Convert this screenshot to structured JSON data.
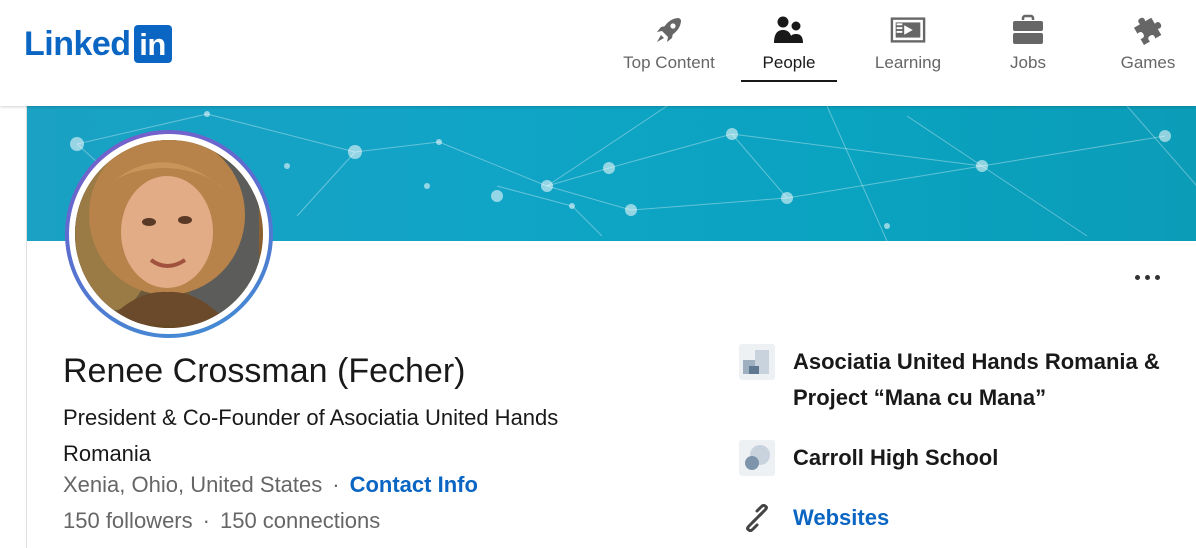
{
  "brand": {
    "logo_text": "Linked",
    "logo_box": "in"
  },
  "nav": {
    "items": [
      {
        "label": "Top Content",
        "icon": "rocket-icon"
      },
      {
        "label": "People",
        "icon": "people-icon",
        "active": true
      },
      {
        "label": "Learning",
        "icon": "learning-icon"
      },
      {
        "label": "Jobs",
        "icon": "briefcase-icon"
      },
      {
        "label": "Games",
        "icon": "puzzle-icon"
      }
    ]
  },
  "profile": {
    "name": "Renee Crossman (Fecher)",
    "headline": "President & Co-Founder of Asociatia United Hands Romania",
    "location": "Xenia, Ohio, United States",
    "contact_info": "Contact Info",
    "followers": "150 followers",
    "connections": "150 connections",
    "separator": "·"
  },
  "sidebar": {
    "company": "Asociatia United Hands Romania & Project “Mana cu Mana”",
    "school": "Carroll High School",
    "websites": "Websites"
  },
  "colors": {
    "brand_blue": "#0a66c2",
    "banner": "#10a4c6",
    "text_primary": "#191919",
    "text_secondary": "#666666"
  }
}
